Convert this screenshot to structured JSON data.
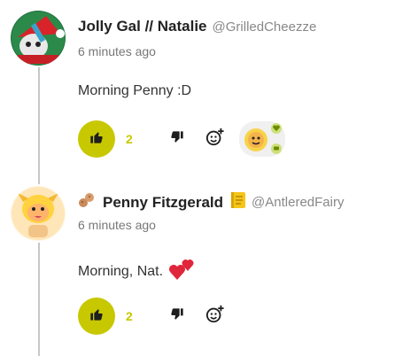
{
  "comments": [
    {
      "display_name": "Jolly Gal // Natalie",
      "handle": "@GrilledCheezze",
      "time": "6 minutes ago",
      "text": "Morning Penny :D",
      "likes": "2"
    },
    {
      "display_name": "Penny Fitzgerald",
      "handle": "@AntleredFairy",
      "time": "6 minutes ago",
      "text": "Morning, Nat.",
      "likes": "2"
    }
  ],
  "colors": {
    "accent": "#c8c800",
    "thread_line": "#c8c8c8",
    "heart": "#e0263a"
  }
}
